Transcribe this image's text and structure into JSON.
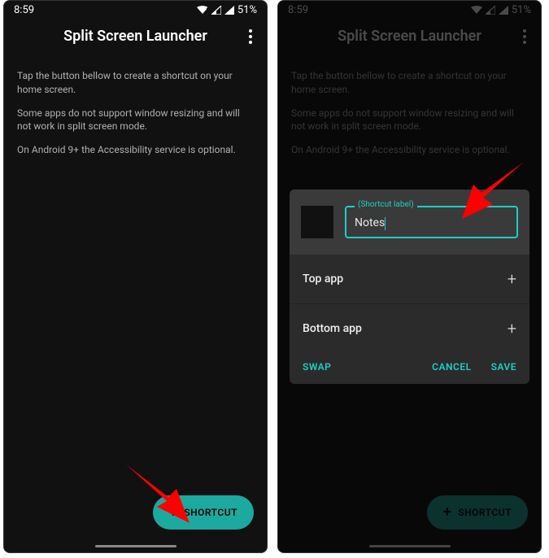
{
  "status": {
    "time": "8:59",
    "battery": "51%"
  },
  "app": {
    "title": "Split Screen Launcher"
  },
  "body": {
    "p1": "Tap the button bellow to create a shortcut on your home screen.",
    "p2": "Some apps do not support window resizing and will not work in split screen mode.",
    "p3": "On Android 9+ the Accessibility service is optional."
  },
  "fab": {
    "label": "SHORTCUT"
  },
  "dialog": {
    "field_label": "(Shortcut label)",
    "field_value": "Notes",
    "row1": "Top app",
    "row2": "Bottom app",
    "swap": "SWAP",
    "cancel": "CANCEL",
    "save": "SAVE"
  }
}
